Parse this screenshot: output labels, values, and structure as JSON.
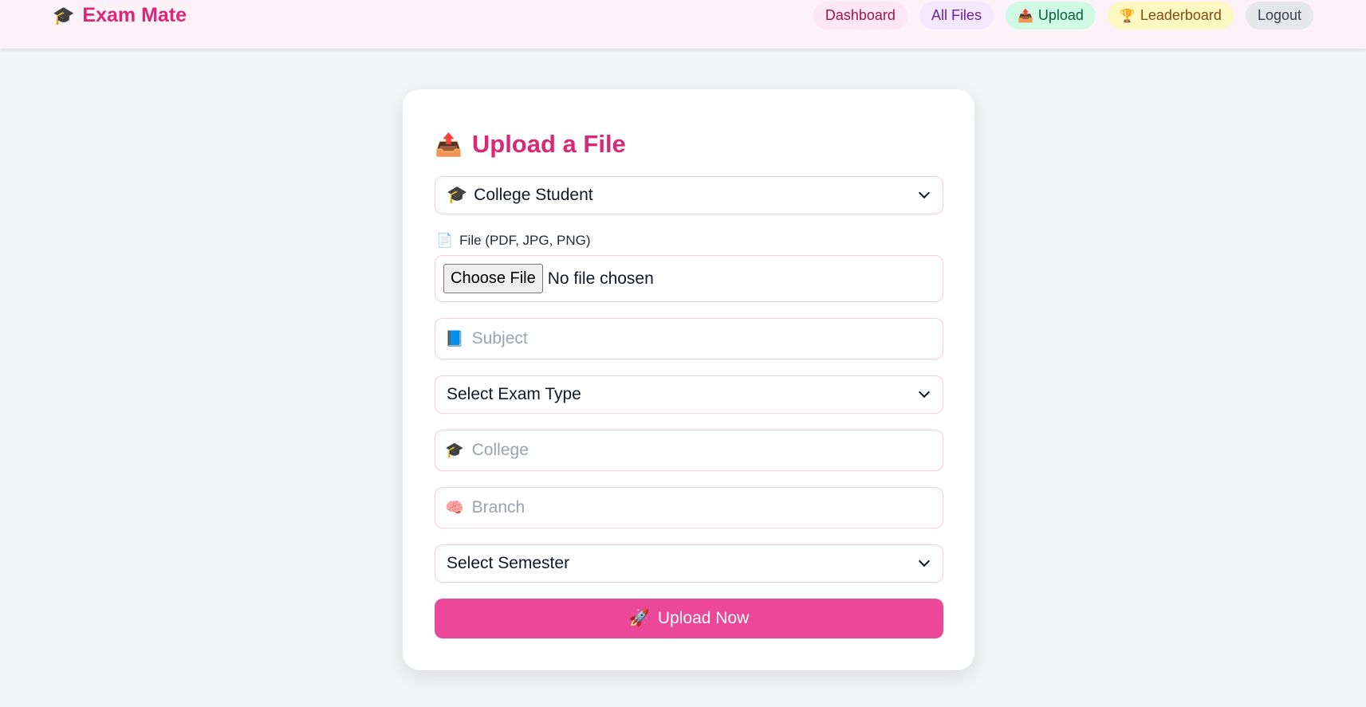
{
  "header": {
    "brand_icon": "🎓",
    "brand_title": "Exam Mate",
    "nav": {
      "dashboard": "Dashboard",
      "all_files": "All Files",
      "upload_icon": "📤",
      "upload": "Upload",
      "leaderboard_icon": "🏆",
      "leaderboard": "Leaderboard",
      "logout": "Logout"
    }
  },
  "form": {
    "title_icon": "📤",
    "title": "Upload a File",
    "role_icon": "🎓",
    "role_selected": "College Student",
    "file_label_icon": "📄",
    "file_label": "File (PDF, JPG, PNG)",
    "choose_file": "Choose File",
    "no_file": "No file chosen",
    "subject_icon": "📘",
    "subject_placeholder": "Subject",
    "exam_type_selected": "Select Exam Type",
    "college_icon": "🎓",
    "college_placeholder": "College",
    "branch_icon": "🧠",
    "branch_placeholder": "Branch",
    "semester_selected": "Select Semester",
    "submit_icon": "🚀",
    "submit_label": "Upload Now"
  },
  "colors": {
    "accent": "#db2777",
    "button": "#ec4899",
    "header_bg": "#fdf2f8",
    "page_bg": "#f3f4f6"
  }
}
